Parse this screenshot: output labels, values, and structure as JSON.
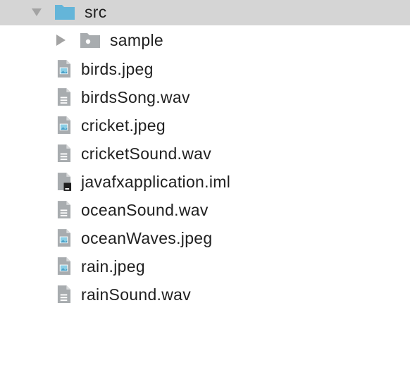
{
  "tree": {
    "root": {
      "label": "src",
      "icon": "folder-icon",
      "color": "#64b5d9"
    },
    "subfolder": {
      "label": "sample",
      "icon": "package-folder-icon"
    },
    "files": [
      {
        "label": "birds.jpeg",
        "icon": "image-file-icon"
      },
      {
        "label": "birdsSong.wav",
        "icon": "text-file-icon"
      },
      {
        "label": "cricket.jpeg",
        "icon": "image-file-icon"
      },
      {
        "label": "cricketSound.wav",
        "icon": "text-file-icon"
      },
      {
        "label": "javafxapplication.iml",
        "icon": "module-file-icon"
      },
      {
        "label": "oceanSound.wav",
        "icon": "text-file-icon"
      },
      {
        "label": "oceanWaves.jpeg",
        "icon": "image-file-icon"
      },
      {
        "label": "rain.jpeg",
        "icon": "image-file-icon"
      },
      {
        "label": "rainSound.wav",
        "icon": "text-file-icon"
      }
    ]
  }
}
